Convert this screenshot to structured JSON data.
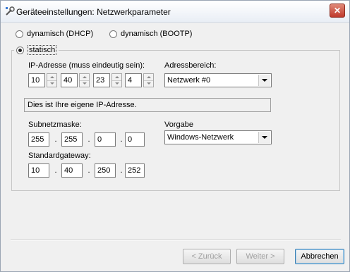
{
  "window": {
    "title": "Geräteeinstellungen: Netzwerkparameter",
    "close_label": "✕"
  },
  "mode": {
    "dhcp_label": "dynamisch (DHCP)",
    "bootp_label": "dynamisch (BOOTP)",
    "static_label": "statisch",
    "selected": "static"
  },
  "ip": {
    "label": "IP-Adresse (muss eindeutig sein):",
    "octets": [
      "10",
      "40",
      "23",
      "4"
    ]
  },
  "range": {
    "label": "Adressbereich:",
    "value": "Netzwerk #0"
  },
  "info": {
    "text": "Dies ist Ihre eigene IP-Adresse."
  },
  "subnet": {
    "label": "Subnetzmaske:",
    "octets": [
      "255",
      "255",
      "0",
      "0"
    ]
  },
  "preset": {
    "label": "Vorgabe",
    "value": "Windows-Netzwerk"
  },
  "gateway": {
    "label": "Standardgateway:",
    "octets": [
      "10",
      "40",
      "250",
      "252"
    ]
  },
  "dot": ".",
  "buttons": {
    "back": "< Zurück",
    "next": "Weiter >",
    "cancel": "Abbrechen"
  }
}
